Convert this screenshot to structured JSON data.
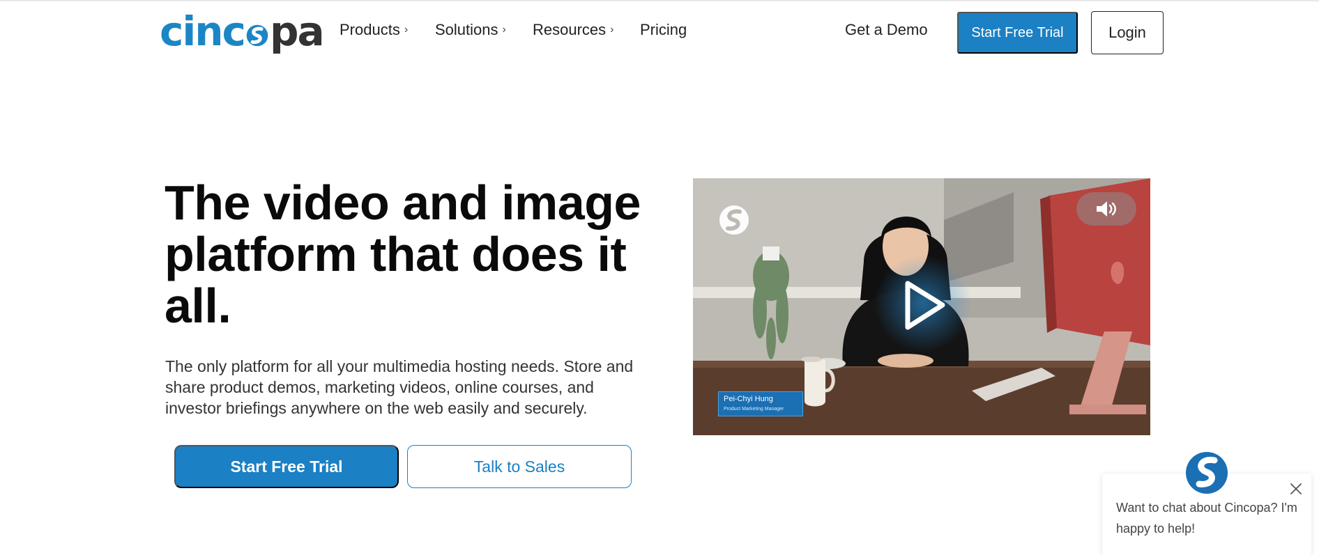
{
  "logo": {
    "part1": "cinc",
    "part2": "pa",
    "mark_icon": "cincopa-s-icon"
  },
  "nav": {
    "items": [
      {
        "label": "Products",
        "chevron": "›"
      },
      {
        "label": "Solutions",
        "chevron": "›"
      },
      {
        "label": "Resources",
        "chevron": "›"
      },
      {
        "label": "Pricing"
      }
    ],
    "get_demo": "Get a Demo",
    "start_trial": "Start Free Trial",
    "login": "Login"
  },
  "hero": {
    "title": "The video and image platform that does it all.",
    "subtitle": "The only platform for all your multimedia hosting needs. Store and share product demos, marketing videos, online courses, and investor briefings anywhere on the web easily and securely.",
    "primary_cta": "Start Free Trial",
    "secondary_cta": "Talk to Sales"
  },
  "video": {
    "presenter_name": "Pei-Chyi Hung",
    "presenter_role": "Product Marketing Manager",
    "icons": [
      "cincopa-watermark-icon",
      "speaker-icon",
      "play-icon"
    ]
  },
  "chat": {
    "message": "Want to chat about Cincopa? I'm happy to help!",
    "icons": [
      "close-icon",
      "cincopa-avatar-icon"
    ]
  },
  "colors": {
    "brand_blue": "#1b80c4",
    "text_dark": "#0a0a0a",
    "text_body": "#333333"
  }
}
